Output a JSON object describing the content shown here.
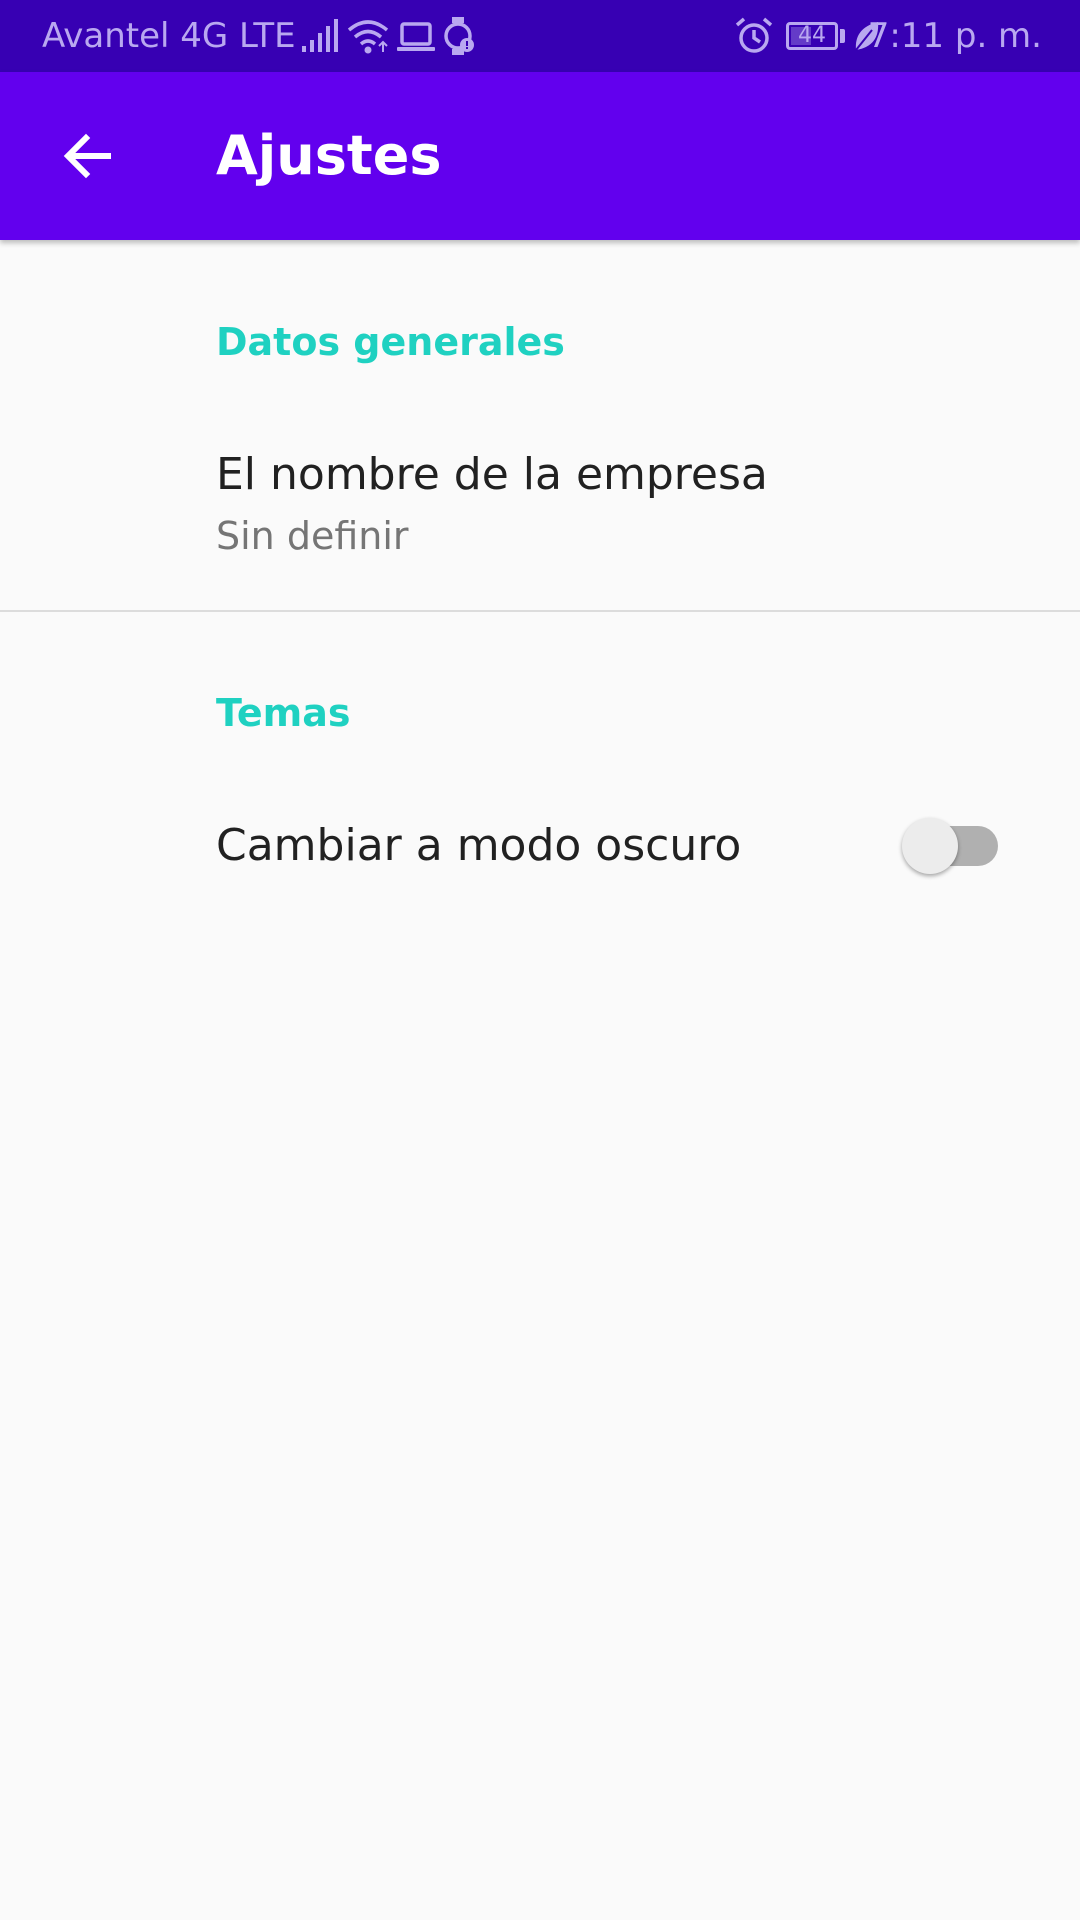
{
  "status_bar": {
    "carrier": "Avantel 4G LTE",
    "battery_level": "44",
    "time": "7:11 p. m.",
    "icons": [
      "signal-icon",
      "wifi-icon",
      "laptop-icon",
      "watch-icon",
      "alarm-icon",
      "battery-icon",
      "leaf-icon"
    ]
  },
  "app_bar": {
    "title": "Ajustes",
    "back_icon": "arrow-left-icon"
  },
  "categories": [
    {
      "title": "Datos generales",
      "preferences": [
        {
          "title": "El nombre de la empresa",
          "summary": "Sin definir"
        }
      ]
    },
    {
      "title": "Temas",
      "preferences": [
        {
          "title": "Cambiar a modo oscuro",
          "switch_on": false
        }
      ]
    }
  ],
  "colors": {
    "status_bar": "#3700B3",
    "app_bar": "#6200EE",
    "category_accent": "#1FD1C1",
    "background": "#FAFAFA"
  }
}
